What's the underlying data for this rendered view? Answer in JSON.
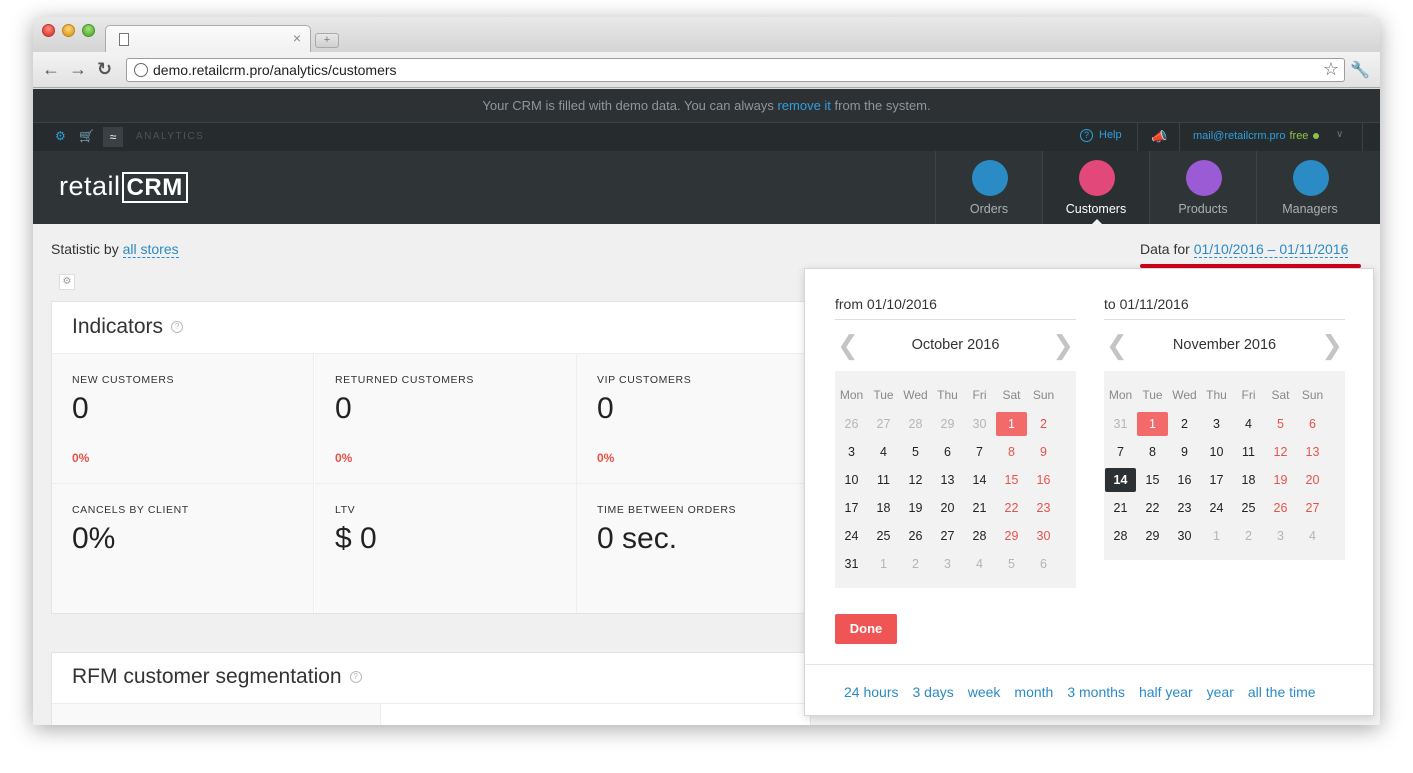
{
  "browser": {
    "url": "demo.retailcrm.pro/analytics/customers",
    "tab_close": "×",
    "new_tab": "+"
  },
  "demo_bar": {
    "before": "Your CRM is filled with demo data. You can always",
    "link": "remove it",
    "after": "from the system."
  },
  "subbar": {
    "section": "ANALYTICS",
    "help": "Help",
    "email": "mail@retailcrm.pro",
    "plan": "free"
  },
  "header": {
    "logo_text": "retail",
    "logo_box": "CRM",
    "nav": [
      {
        "label": "Orders"
      },
      {
        "label": "Customers"
      },
      {
        "label": "Products"
      },
      {
        "label": "Managers"
      }
    ]
  },
  "filters": {
    "statistic_prefix": "Statistic by",
    "stores_link": "all stores",
    "data_prefix": "Data for",
    "date_range": "01/10/2016 – 01/11/2016"
  },
  "indicators": {
    "title": "Indicators",
    "cells": [
      {
        "caption": "NEW CUSTOMERS",
        "value": "0",
        "change": "0%"
      },
      {
        "caption": "RETURNED CUSTOMERS",
        "value": "0",
        "change": "0%"
      },
      {
        "caption": "VIP CUSTOMERS",
        "value": "0",
        "change": "0%"
      },
      {
        "caption": "CANCELS BY CLIENT",
        "value": "0%"
      },
      {
        "caption": "LTV",
        "value": "$ 0"
      },
      {
        "caption": "TIME BETWEEN ORDERS",
        "value": "0 sec."
      }
    ]
  },
  "rfm": {
    "title": "RFM customer segmentation"
  },
  "datepicker": {
    "from_label": "from",
    "from_date": "01/10/2016",
    "to_label": "to",
    "to_date": "01/11/2016",
    "weekdays": [
      "Mon",
      "Tue",
      "Wed",
      "Thu",
      "Fri",
      "Sat",
      "Sun"
    ],
    "left_month": "October 2016",
    "right_month": "November 2016",
    "left_weeks": [
      [
        "26",
        "27",
        "28",
        "29",
        "30",
        "1",
        "2"
      ],
      [
        "3",
        "4",
        "5",
        "6",
        "7",
        "8",
        "9"
      ],
      [
        "10",
        "11",
        "12",
        "13",
        "14",
        "15",
        "16"
      ],
      [
        "17",
        "18",
        "19",
        "20",
        "21",
        "22",
        "23"
      ],
      [
        "24",
        "25",
        "26",
        "27",
        "28",
        "29",
        "30"
      ],
      [
        "31",
        "1",
        "2",
        "3",
        "4",
        "5",
        "6"
      ]
    ],
    "right_weeks": [
      [
        "31",
        "1",
        "2",
        "3",
        "4",
        "5",
        "6"
      ],
      [
        "7",
        "8",
        "9",
        "10",
        "11",
        "12",
        "13"
      ],
      [
        "14",
        "15",
        "16",
        "17",
        "18",
        "19",
        "20"
      ],
      [
        "21",
        "22",
        "23",
        "24",
        "25",
        "26",
        "27"
      ],
      [
        "28",
        "29",
        "30",
        "1",
        "2",
        "3",
        "4"
      ]
    ],
    "done_label": "Done",
    "quick_ranges": [
      "24 hours",
      "3 days",
      "week",
      "month",
      "3 months",
      "half year",
      "year",
      "all the time"
    ]
  },
  "colors": {
    "accent": "#2a8bc5",
    "danger": "#f05555",
    "header_bg": "#2f3537"
  }
}
